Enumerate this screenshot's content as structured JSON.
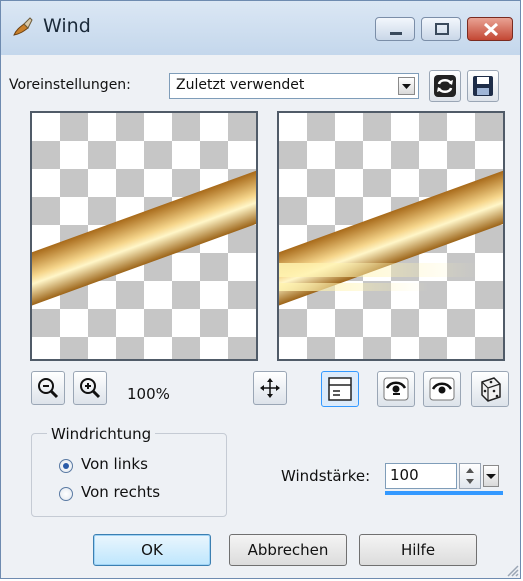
{
  "window": {
    "title": "Wind"
  },
  "presets": {
    "label": "Voreinstellungen:",
    "selected": "Zuletzt verwendet"
  },
  "zoom": {
    "level": "100%"
  },
  "direction": {
    "group_title": "Windrichtung",
    "options": [
      "Von links",
      "Von rechts"
    ],
    "selected": "Von links"
  },
  "strength": {
    "label": "Windstärke:",
    "value": "100"
  },
  "buttons": {
    "ok": "OK",
    "cancel": "Abbrechen",
    "help": "Hilfe"
  }
}
